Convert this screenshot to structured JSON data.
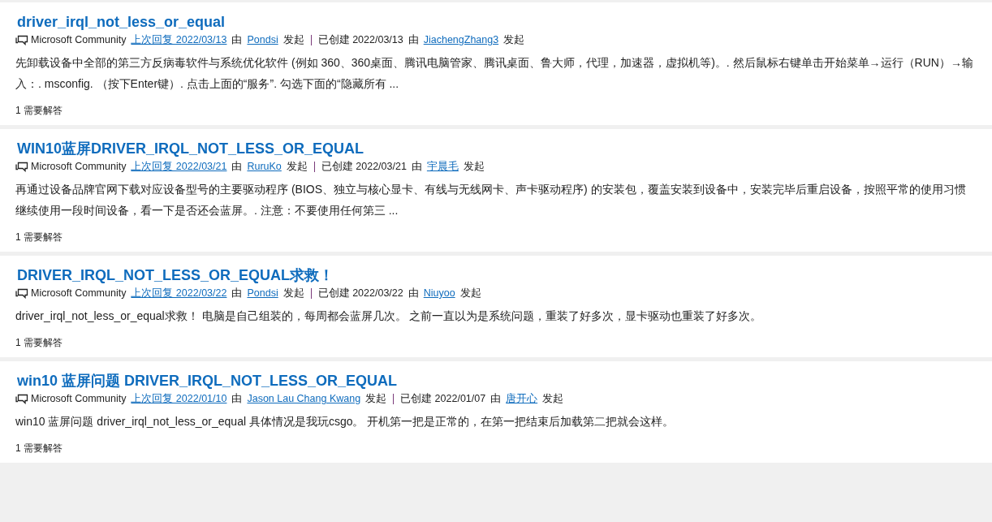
{
  "results": [
    {
      "title": "driver_irql_not_less_or_equal",
      "source": "Microsoft Community",
      "last_reply": "上次回复 2022/03/13",
      "by_1": "由",
      "replier": "Pondsi",
      "started_1": "发起",
      "created": "已创建 2022/03/13",
      "by_2": "由",
      "creator": "JiachengZhang3",
      "started_2": "发起",
      "snippet": "先卸载设备中全部的第三方反病毒软件与系统优化软件 (例如 360、360桌面、腾讯电脑管家、腾讯桌面、鲁大师，代理，加速器，虚拟机等)。. 然后鼠标右键单击开始菜单→运行（RUN）→输入：. msconfig. （按下Enter键）. 点击上面的“服务”. 勾选下面的“隐藏所有 ...",
      "answers": "1 需要解答"
    },
    {
      "title": "WIN10蓝屏DRIVER_IRQL_NOT_LESS_OR_EQUAL",
      "source": "Microsoft Community",
      "last_reply": "上次回复 2022/03/21",
      "by_1": "由",
      "replier": "RuruKo",
      "started_1": "发起",
      "created": "已创建 2022/03/21",
      "by_2": "由",
      "creator": "宇晨毛",
      "started_2": "发起",
      "snippet": "再通过设备品牌官网下载对应设备型号的主要驱动程序 (BIOS、独立与核心显卡、有线与无线网卡、声卡驱动程序) 的安装包，覆盖安装到设备中，安装完毕后重启设备，按照平常的使用习惯继续使用一段时间设备，看一下是否还会蓝屏。. 注意：不要使用任何第三 ...",
      "answers": "1 需要解答"
    },
    {
      "title": "DRIVER_IRQL_NOT_LESS_OR_EQUAL求救！",
      "source": "Microsoft Community",
      "last_reply": "上次回复 2022/03/22",
      "by_1": "由",
      "replier": "Pondsi",
      "started_1": "发起",
      "created": "已创建 2022/03/22",
      "by_2": "由",
      "creator": "Niuyoo",
      "started_2": "发起",
      "snippet": "driver_irql_not_less_or_equal求救！ 电脑是自己组装的，每周都会蓝屏几次。 之前一直以为是系统问题，重装了好多次，显卡驱动也重装了好多次。",
      "answers": "1 需要解答"
    },
    {
      "title": "win10 蓝屏问题 DRIVER_IRQL_NOT_LESS_OR_EQUAL",
      "source": "Microsoft Community",
      "last_reply": "上次回复 2022/01/10",
      "by_1": "由",
      "replier": "Jason Lau Chang Kwang",
      "started_1": "发起",
      "created": "已创建 2022/01/07",
      "by_2": "由",
      "creator": "唐开心",
      "started_2": "发起",
      "snippet": "win10 蓝屏问题 driver_irql_not_less_or_equal 具体情况是我玩csgo。 开机第一把是正常的，在第一把结束后加载第二把就会这样。",
      "answers": "1 需要解答"
    }
  ]
}
